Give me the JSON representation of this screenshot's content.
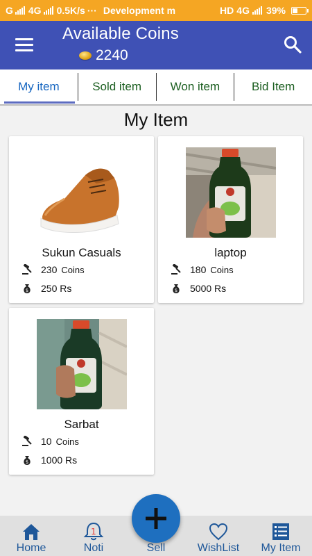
{
  "status_bar": {
    "carrier_left": "G",
    "network_left": "4G",
    "speed": "0.5K/s",
    "dots": "···",
    "notification": "Development m",
    "hd": "HD",
    "network_right": "4G",
    "battery": "39%"
  },
  "app_bar": {
    "title": "Available Coins",
    "coins": "2240",
    "menu_icon": "hamburger-menu-icon",
    "search_icon": "search-icon"
  },
  "tabs": [
    {
      "label": "My item",
      "active": true
    },
    {
      "label": "Sold item",
      "active": false
    },
    {
      "label": "Won item",
      "active": false
    },
    {
      "label": "Bid Item",
      "active": false
    }
  ],
  "page_heading": "My Item",
  "items": [
    {
      "name": "Sukun Casuals",
      "coins": "230",
      "coins_unit": "Coins",
      "price": "250 Rs",
      "image": "shoe"
    },
    {
      "name": "laptop",
      "coins": "180",
      "coins_unit": "Coins",
      "price": "5000 Rs",
      "image": "bottle"
    },
    {
      "name": "Sarbat",
      "coins": "10",
      "coins_unit": "Coins",
      "price": "1000 Rs",
      "image": "bottle"
    }
  ],
  "bottom_nav": {
    "home": "Home",
    "noti": "Noti",
    "noti_badge": "1",
    "sell": "Sell",
    "wishlist": "WishList",
    "my_item": "My Item"
  },
  "colors": {
    "status_bar": "#f5a623",
    "app_bar": "#3f51b5",
    "tab_text": "#1b5e20",
    "tab_active": "#1565c0",
    "nav_accent": "#1e5799",
    "fab": "#1e6fbf"
  }
}
